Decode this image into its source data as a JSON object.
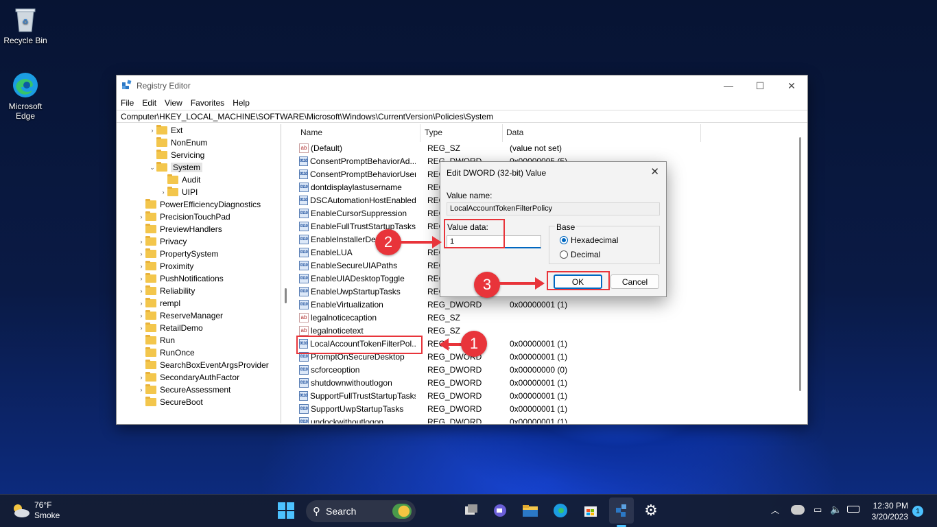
{
  "desktop": {
    "icons": [
      {
        "label": "Recycle Bin"
      },
      {
        "label": "Microsoft Edge"
      }
    ]
  },
  "window": {
    "title": "Registry Editor",
    "menu": [
      "File",
      "Edit",
      "View",
      "Favorites",
      "Help"
    ],
    "address": "Computer\\HKEY_LOCAL_MACHINE\\SOFTWARE\\Microsoft\\Windows\\CurrentVersion\\Policies\\System",
    "tree": [
      {
        "label": "Ext",
        "level": 2,
        "expand": "collapsed"
      },
      {
        "label": "NonEnum",
        "level": 2,
        "expand": "none"
      },
      {
        "label": "Servicing",
        "level": 2,
        "expand": "none"
      },
      {
        "label": "System",
        "level": 2,
        "expand": "expanded",
        "selected": true
      },
      {
        "label": "Audit",
        "level": 3,
        "expand": "none"
      },
      {
        "label": "UIPI",
        "level": 3,
        "expand": "collapsed"
      },
      {
        "label": "PowerEfficiencyDiagnostics",
        "level": 1,
        "expand": "none"
      },
      {
        "label": "PrecisionTouchPad",
        "level": 1,
        "expand": "collapsed"
      },
      {
        "label": "PreviewHandlers",
        "level": 1,
        "expand": "none"
      },
      {
        "label": "Privacy",
        "level": 1,
        "expand": "collapsed"
      },
      {
        "label": "PropertySystem",
        "level": 1,
        "expand": "collapsed"
      },
      {
        "label": "Proximity",
        "level": 1,
        "expand": "collapsed"
      },
      {
        "label": "PushNotifications",
        "level": 1,
        "expand": "collapsed"
      },
      {
        "label": "Reliability",
        "level": 1,
        "expand": "collapsed"
      },
      {
        "label": "rempl",
        "level": 1,
        "expand": "collapsed"
      },
      {
        "label": "ReserveManager",
        "level": 1,
        "expand": "collapsed"
      },
      {
        "label": "RetailDemo",
        "level": 1,
        "expand": "collapsed"
      },
      {
        "label": "Run",
        "level": 1,
        "expand": "none"
      },
      {
        "label": "RunOnce",
        "level": 1,
        "expand": "none"
      },
      {
        "label": "SearchBoxEventArgsProvider",
        "level": 1,
        "expand": "none"
      },
      {
        "label": "SecondaryAuthFactor",
        "level": 1,
        "expand": "collapsed"
      },
      {
        "label": "SecureAssessment",
        "level": 1,
        "expand": "collapsed"
      },
      {
        "label": "SecureBoot",
        "level": 1,
        "expand": "none"
      }
    ],
    "columns": {
      "name": "Name",
      "type": "Type",
      "data": "Data"
    },
    "values": [
      {
        "name": "(Default)",
        "type": "REG_SZ",
        "data": "(value not set)",
        "icon": "ab"
      },
      {
        "name": "ConsentPromptBehaviorAd...",
        "type": "REG_DWORD",
        "data": "0x00000005 (5)",
        "icon": "bin"
      },
      {
        "name": "ConsentPromptBehaviorUser",
        "type": "REG_",
        "data": "",
        "icon": "bin"
      },
      {
        "name": "dontdisplaylastusername",
        "type": "REG_",
        "data": "",
        "icon": "bin"
      },
      {
        "name": "DSCAutomationHostEnabled",
        "type": "REG_",
        "data": "",
        "icon": "bin"
      },
      {
        "name": "EnableCursorSuppression",
        "type": "REG_",
        "data": "",
        "icon": "bin"
      },
      {
        "name": "EnableFullTrustStartupTasks",
        "type": "REG_",
        "data": "",
        "icon": "bin"
      },
      {
        "name": "EnableInstallerDet",
        "type": "",
        "data": "",
        "icon": "bin"
      },
      {
        "name": "EnableLUA",
        "type": "REG_",
        "data": "",
        "icon": "bin"
      },
      {
        "name": "EnableSecureUIAPaths",
        "type": "REG_",
        "data": "",
        "icon": "bin"
      },
      {
        "name": "EnableUIADesktopToggle",
        "type": "REG_",
        "data": "",
        "icon": "bin"
      },
      {
        "name": "EnableUwpStartupTasks",
        "type": "REG_",
        "data": "",
        "icon": "bin"
      },
      {
        "name": "EnableVirtualization",
        "type": "REG_DWORD",
        "data": "0x00000001 (1)",
        "icon": "bin"
      },
      {
        "name": "legalnoticecaption",
        "type": "REG_SZ",
        "data": "",
        "icon": "ab"
      },
      {
        "name": "legalnoticetext",
        "type": "REG_SZ",
        "data": "",
        "icon": "ab"
      },
      {
        "name": "LocalAccountTokenFilterPol...",
        "type": "REG_",
        "data": "0x00000001 (1)",
        "icon": "bin",
        "selected": true
      },
      {
        "name": "PromptOnSecureDesktop",
        "type": "REG_DWORD",
        "data": "0x00000001 (1)",
        "icon": "bin"
      },
      {
        "name": "scforceoption",
        "type": "REG_DWORD",
        "data": "0x00000000 (0)",
        "icon": "bin"
      },
      {
        "name": "shutdownwithoutlogon",
        "type": "REG_DWORD",
        "data": "0x00000001 (1)",
        "icon": "bin"
      },
      {
        "name": "SupportFullTrustStartupTasks",
        "type": "REG_DWORD",
        "data": "0x00000001 (1)",
        "icon": "bin"
      },
      {
        "name": "SupportUwpStartupTasks",
        "type": "REG_DWORD",
        "data": "0x00000001 (1)",
        "icon": "bin"
      },
      {
        "name": "undockwithoutlogon",
        "type": "REG_DWORD",
        "data": "0x00000001 (1)",
        "icon": "bin"
      }
    ]
  },
  "dialog": {
    "title": "Edit DWORD (32-bit) Value",
    "value_name_label": "Value name:",
    "value_name": "LocalAccountTokenFilterPolicy",
    "value_data_label": "Value data:",
    "value_data": "1",
    "base_label": "Base",
    "base_options": [
      "Hexadecimal",
      "Decimal"
    ],
    "base_selected": "Hexadecimal",
    "ok_label": "OK",
    "cancel_label": "Cancel",
    "close_glyph": "✕"
  },
  "markers": [
    "1",
    "2",
    "3"
  ],
  "taskbar": {
    "weather_temp": "76°F",
    "weather_desc": "Smoke",
    "search_label": "Search",
    "time": "12:30 PM",
    "date": "3/20/2023",
    "notification_count": "1"
  },
  "colors": {
    "accent": "#0067c0",
    "highlight": "#e8343a"
  }
}
